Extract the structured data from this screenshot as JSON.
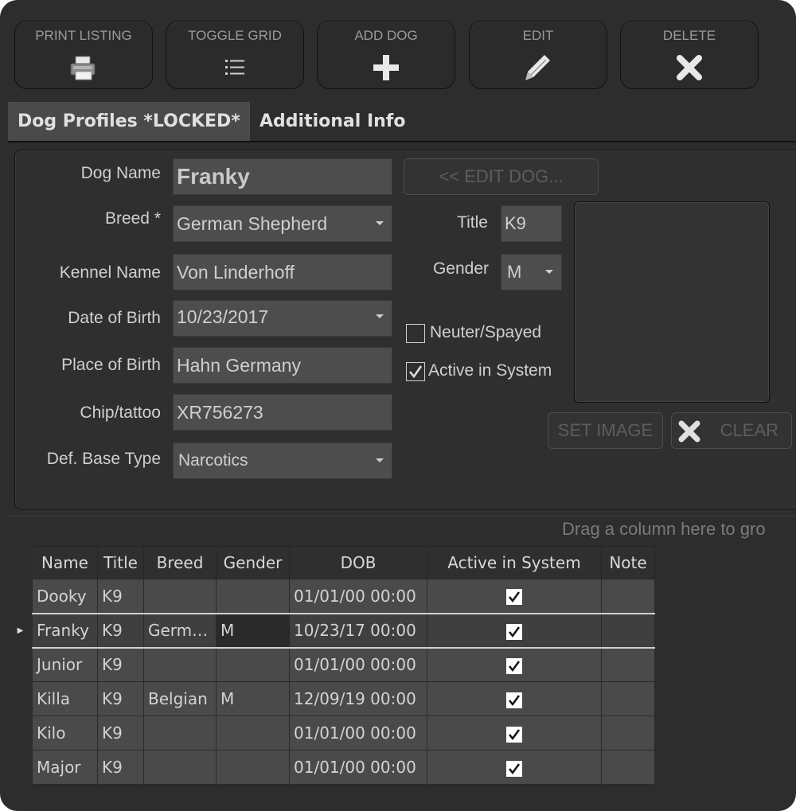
{
  "toolbar": {
    "print_label": "PRINT LISTING",
    "toggle_label": "TOGGLE GRID",
    "add_label": "ADD DOG",
    "edit_label": "EDIT",
    "delete_label": "DELETE"
  },
  "tabs": {
    "profiles": "Dog Profiles *LOCKED*",
    "additional": "Additional Info"
  },
  "form": {
    "dog_name_label": "Dog Name",
    "dog_name_value": "Franky",
    "breed_label": "Breed *",
    "breed_value": "German Shepherd",
    "kennel_label": "Kennel Name",
    "kennel_value": "Von Linderhoff",
    "dob_label": "Date of Birth",
    "dob_value": "10/23/2017",
    "pob_label": "Place of Birth",
    "pob_value": "Hahn Germany",
    "chip_label": "Chip/tattoo",
    "chip_value": "XR756273",
    "base_label": "Def. Base Type",
    "base_value": "Narcotics",
    "edit_dog_button": "<< EDIT DOG...",
    "title_label": "Title",
    "title_value": "K9",
    "gender_label": "Gender",
    "gender_value": "M",
    "neuter_label": "Neuter/Spayed",
    "neuter_checked": false,
    "active_label": "Active in System",
    "active_checked": true,
    "set_image_button": "SET IMAGE",
    "clear_button": "CLEAR"
  },
  "grid": {
    "group_hint": "Drag a column here to gro",
    "columns": [
      "Name",
      "Title",
      "Breed",
      "Gender",
      "DOB",
      "Active in System",
      "Note"
    ],
    "rows": [
      {
        "name": "Dooky",
        "title": "K9",
        "breed": "",
        "gender": "",
        "dob": "01/01/00 00:00",
        "active": true,
        "note": ""
      },
      {
        "name": "Franky",
        "title": "K9",
        "breed": "Germ…",
        "gender": "M",
        "dob": "10/23/17 00:00",
        "active": true,
        "note": "",
        "selected": true
      },
      {
        "name": "Junior",
        "title": "K9",
        "breed": "",
        "gender": "",
        "dob": "01/01/00 00:00",
        "active": true,
        "note": ""
      },
      {
        "name": "Killa",
        "title": "K9",
        "breed": "Belgian",
        "gender": "M",
        "dob": "12/09/19 00:00",
        "active": true,
        "note": ""
      },
      {
        "name": "Kilo",
        "title": "K9",
        "breed": "",
        "gender": "",
        "dob": "01/01/00 00:00",
        "active": true,
        "note": ""
      },
      {
        "name": "Major",
        "title": "K9",
        "breed": "",
        "gender": "",
        "dob": "01/01/00 00:00",
        "active": true,
        "note": ""
      }
    ]
  },
  "colors": {
    "window_bg": "#2d2d2d",
    "field_bg": "#4d4d4d",
    "selected_tab_bg": "#4a4a4a"
  }
}
